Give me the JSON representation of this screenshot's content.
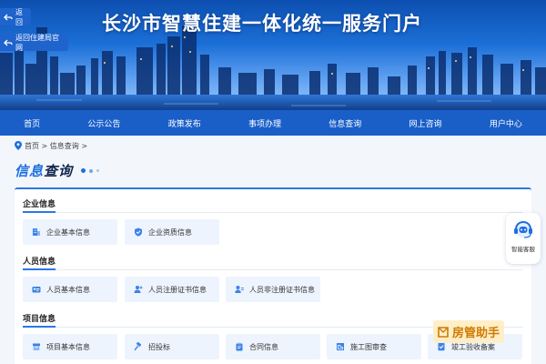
{
  "header": {
    "title": "长沙市智慧住建一体化统一服务门户",
    "back_label": "返回",
    "back_home_label": "返回住建局官网"
  },
  "nav": [
    {
      "label": "首页"
    },
    {
      "label": "公示公告"
    },
    {
      "label": "政策发布"
    },
    {
      "label": "事项办理"
    },
    {
      "label": "信息查询"
    },
    {
      "label": "网上咨询"
    },
    {
      "label": "用户中心"
    }
  ],
  "breadcrumb": {
    "text": "首页 > 信息查询 >"
  },
  "heading": {
    "part1": "信息",
    "part2": "查询"
  },
  "groups": [
    {
      "title": "企业信息",
      "items": [
        {
          "label": "企业基本信息",
          "icon": "building-icon"
        },
        {
          "label": "企业资质信息",
          "icon": "shield-check-icon"
        }
      ]
    },
    {
      "title": "人员信息",
      "items": [
        {
          "label": "人员基本信息",
          "icon": "id-card-icon"
        },
        {
          "label": "人员注册证书信息",
          "icon": "user-add-icon"
        },
        {
          "label": "人员非注册证书信息",
          "icon": "user-card-icon"
        }
      ]
    },
    {
      "title": "项目信息",
      "items": [
        {
          "label": "项目基本信息",
          "icon": "box-icon"
        },
        {
          "label": "招投标",
          "icon": "hammer-icon"
        },
        {
          "label": "合同信息",
          "icon": "clipboard-icon"
        },
        {
          "label": "施工图审查",
          "icon": "blueprint-icon"
        },
        {
          "label": "竣工验收备案",
          "icon": "check-doc-icon"
        }
      ]
    }
  ],
  "service": {
    "label": "智能客服"
  },
  "watermark": {
    "text": "房管助手"
  },
  "colors": {
    "primary": "#1a5fc8",
    "accent": "#1e6ee0",
    "tile_bg": "#eef4fe",
    "watermark": "#d07a00"
  }
}
